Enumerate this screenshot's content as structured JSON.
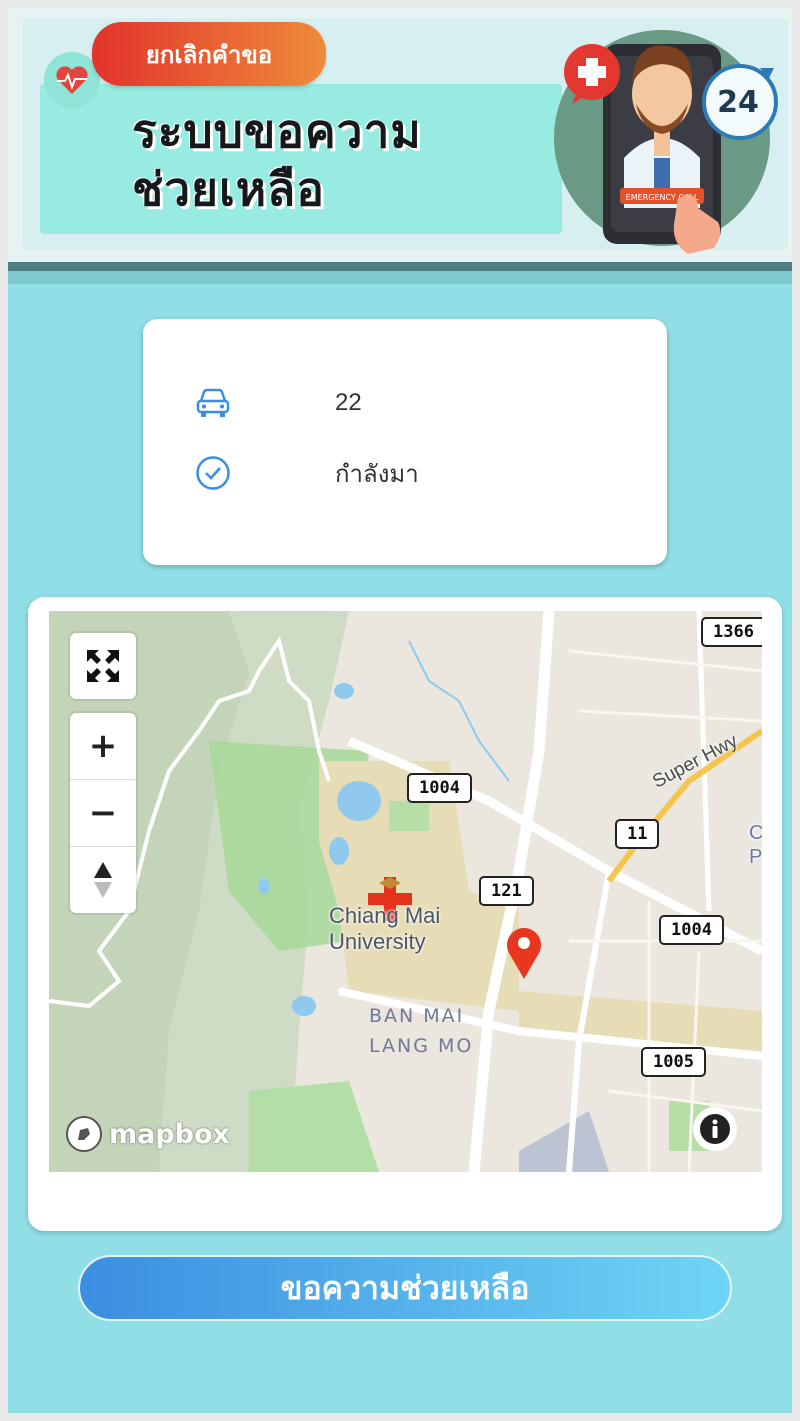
{
  "header": {
    "cancel_label": "ยกเลิกคำขอ",
    "title_line1": "ระบบขอความ",
    "title_line2": "ช่วยเหลือ",
    "art_text_24": "24",
    "art_emergency_call": "EMERGENCY CALL"
  },
  "status": {
    "vehicle_icon": "car-icon",
    "vehicle_value": "22",
    "state_icon": "check-circle-icon",
    "state_value": "กำลังมา"
  },
  "map": {
    "provider": "mapbox",
    "controls": {
      "fullscreen_icon": "fullscreen-icon",
      "zoom_in": "+",
      "zoom_out": "−",
      "compass_icon": "compass-icon"
    },
    "road_labels": [
      "1366",
      "1004",
      "11",
      "121",
      "1004",
      "1005"
    ],
    "highway_label": "Super Hwy",
    "place_label_line1": "Chiang Mai",
    "place_label_line2": "University",
    "neighborhood_line1": "BAN MAI",
    "neighborhood_line2": "LANG MO",
    "edge_labels": [
      "C",
      "P"
    ],
    "marker_icon": "map-pin-icon",
    "info_icon": "info-icon"
  },
  "actions": {
    "request_help_label": "ขอความช่วยเหลือ"
  },
  "colors": {
    "page_bg": "#91dfe6",
    "accent_blue": "#3b8ee0",
    "cancel_red": "#e2332c",
    "marker_red": "#e8361f"
  }
}
